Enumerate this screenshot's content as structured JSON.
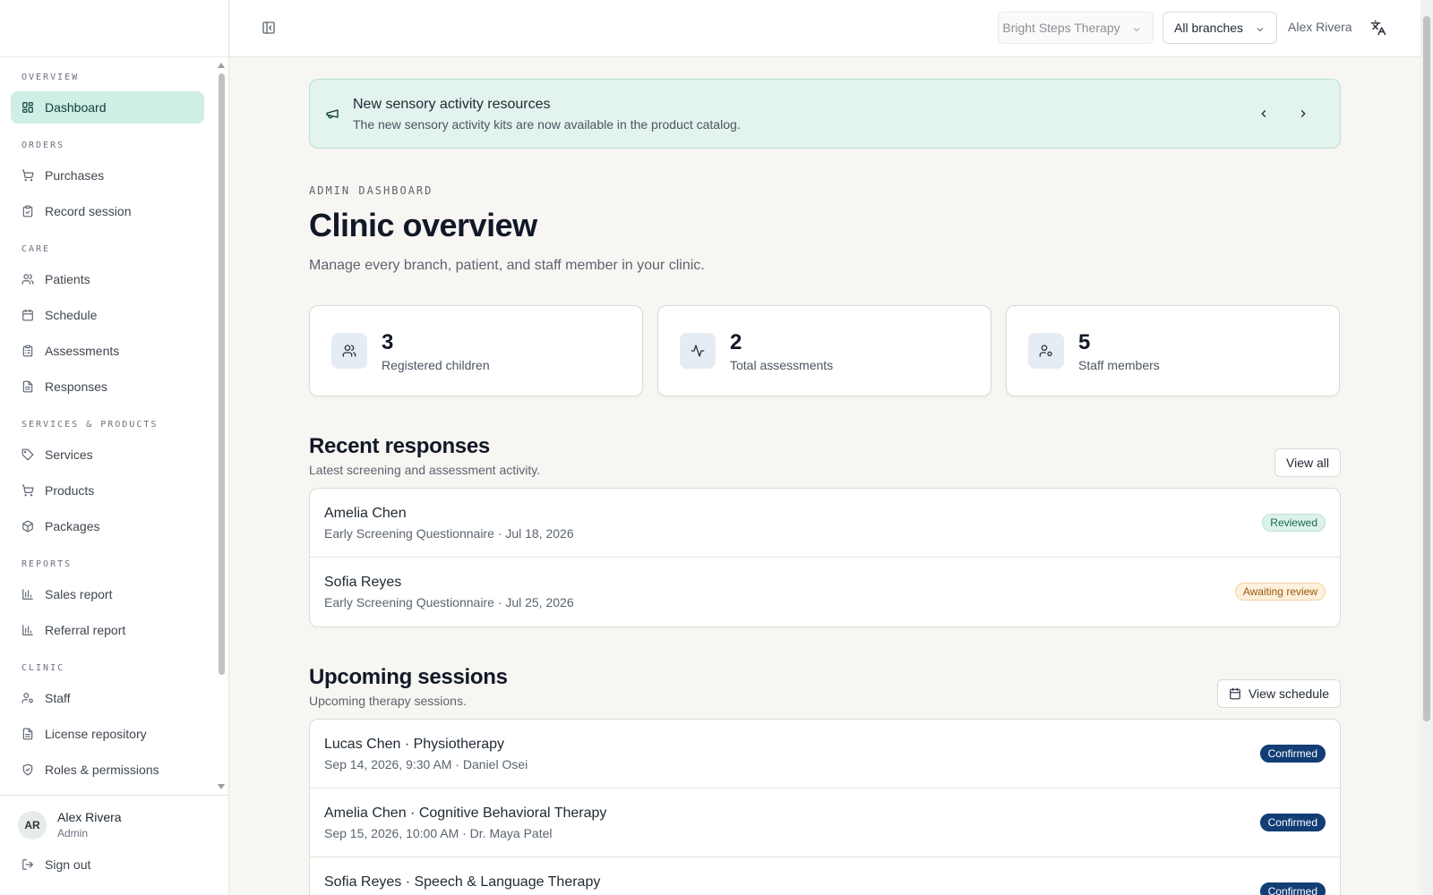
{
  "sidebar": {
    "sections": [
      {
        "title": "OVERVIEW",
        "items": [
          {
            "label": "Dashboard",
            "icon": "dashboard-icon",
            "active": true
          }
        ]
      },
      {
        "title": "ORDERS",
        "items": [
          {
            "label": "Purchases",
            "icon": "cart-icon"
          },
          {
            "label": "Record session",
            "icon": "clipboard-check-icon"
          }
        ]
      },
      {
        "title": "CARE",
        "items": [
          {
            "label": "Patients",
            "icon": "users-icon"
          },
          {
            "label": "Schedule",
            "icon": "calendar-icon"
          },
          {
            "label": "Assessments",
            "icon": "clipboard-list-icon"
          },
          {
            "label": "Responses",
            "icon": "file-text-icon"
          }
        ]
      },
      {
        "title": "SERVICES & PRODUCTS",
        "items": [
          {
            "label": "Services",
            "icon": "tag-icon"
          },
          {
            "label": "Products",
            "icon": "cart-icon"
          },
          {
            "label": "Packages",
            "icon": "package-icon"
          }
        ]
      },
      {
        "title": "REPORTS",
        "items": [
          {
            "label": "Sales report",
            "icon": "bar-chart-icon"
          },
          {
            "label": "Referral report",
            "icon": "bar-chart-icon"
          }
        ]
      },
      {
        "title": "CLINIC",
        "items": [
          {
            "label": "Staff",
            "icon": "user-cog-icon"
          },
          {
            "label": "License repository",
            "icon": "file-text-icon"
          },
          {
            "label": "Roles & permissions",
            "icon": "shield-check-icon"
          }
        ]
      }
    ],
    "user": {
      "initials": "AR",
      "name": "Alex Rivera",
      "role": "Admin"
    },
    "sign_out_label": "Sign out"
  },
  "header": {
    "org": "Bright Steps Therapy",
    "branch": "All branches",
    "user_name": "Alex Rivera"
  },
  "banner": {
    "title": "New sensory activity resources",
    "text": "The new sensory activity kits are now available in the product catalog."
  },
  "page": {
    "eyebrow": "ADMIN DASHBOARD",
    "title": "Clinic overview",
    "subtitle": "Manage every branch, patient, and staff member in your clinic."
  },
  "stats": [
    {
      "value": "3",
      "label": "Registered children",
      "icon": "users-icon"
    },
    {
      "value": "2",
      "label": "Total assessments",
      "icon": "activity-icon"
    },
    {
      "value": "5",
      "label": "Staff members",
      "icon": "user-cog-icon"
    }
  ],
  "recent_responses": {
    "title": "Recent responses",
    "subtitle": "Latest screening and assessment activity.",
    "button": "View all",
    "rows": [
      {
        "name": "Amelia Chen",
        "detail": "Early Screening Questionnaire · Jul 18, 2026",
        "status": "Reviewed"
      },
      {
        "name": "Sofia Reyes",
        "detail": "Early Screening Questionnaire · Jul 25, 2026",
        "status": "Awaiting review"
      }
    ]
  },
  "upcoming_sessions": {
    "title": "Upcoming sessions",
    "subtitle": "Upcoming therapy sessions.",
    "button": "View schedule",
    "rows": [
      {
        "name": "Lucas Chen · Physiotherapy",
        "detail": "Sep 14, 2026, 9:30 AM · Daniel Osei",
        "status": "Confirmed"
      },
      {
        "name": "Amelia Chen · Cognitive Behavioral Therapy",
        "detail": "Sep 15, 2026, 10:00 AM · Dr. Maya Patel",
        "status": "Confirmed"
      },
      {
        "name": "Sofia Reyes · Speech & Language Therapy",
        "detail": "",
        "status": "Confirmed"
      }
    ]
  },
  "colors": {
    "accent": "#cfeee6",
    "banner_bg": "#e3f3ee",
    "confirmed": "#123d75",
    "reviewed": "#ddf2ea",
    "awaiting": "#fdf0dc"
  }
}
